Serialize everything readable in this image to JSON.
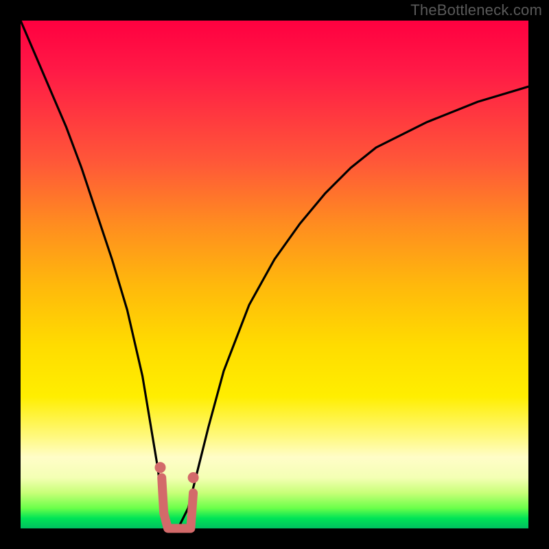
{
  "watermark": "TheBottleneck.com",
  "chart_data": {
    "type": "line",
    "title": "",
    "xlabel": "",
    "ylabel": "",
    "xlim": [
      0,
      100
    ],
    "ylim": [
      0,
      100
    ],
    "grid": false,
    "legend": false,
    "background": {
      "direction": "top-to-bottom",
      "stops": [
        {
          "pos": 0,
          "color": "#ff0040"
        },
        {
          "pos": 10,
          "color": "#ff1a46"
        },
        {
          "pos": 28,
          "color": "#ff5838"
        },
        {
          "pos": 40,
          "color": "#ff8c20"
        },
        {
          "pos": 52,
          "color": "#ffb80c"
        },
        {
          "pos": 64,
          "color": "#ffdc00"
        },
        {
          "pos": 74,
          "color": "#ffee00"
        },
        {
          "pos": 82,
          "color": "#fff980"
        },
        {
          "pos": 90,
          "color": "#f4ffb4"
        },
        {
          "pos": 96,
          "color": "#6bff4a"
        },
        {
          "pos": 100,
          "color": "#00c060"
        }
      ]
    },
    "series": [
      {
        "name": "bottleneck-curve",
        "color": "#000000",
        "x": [
          0,
          3,
          6,
          9,
          12,
          15,
          18,
          21,
          24,
          26,
          27,
          28,
          29,
          30,
          31,
          33,
          35,
          37,
          40,
          45,
          50,
          55,
          60,
          65,
          70,
          80,
          90,
          100
        ],
        "y": [
          100,
          93,
          86,
          79,
          71,
          62,
          53,
          43,
          30,
          18,
          12,
          4,
          0,
          0,
          0,
          4,
          12,
          20,
          31,
          44,
          53,
          60,
          66,
          71,
          75,
          80,
          84,
          87
        ]
      }
    ],
    "accent": {
      "name": "optimal-range",
      "color": "#d36a6a",
      "start_dot": {
        "x": 27.5,
        "y": 12
      },
      "end_dot": {
        "x": 34.0,
        "y": 10
      },
      "path": [
        {
          "x": 27.8,
          "y": 10
        },
        {
          "x": 28.2,
          "y": 3
        },
        {
          "x": 29.0,
          "y": 0
        },
        {
          "x": 31.5,
          "y": 0
        },
        {
          "x": 33.5,
          "y": 0
        },
        {
          "x": 34.0,
          "y": 7
        }
      ]
    }
  }
}
